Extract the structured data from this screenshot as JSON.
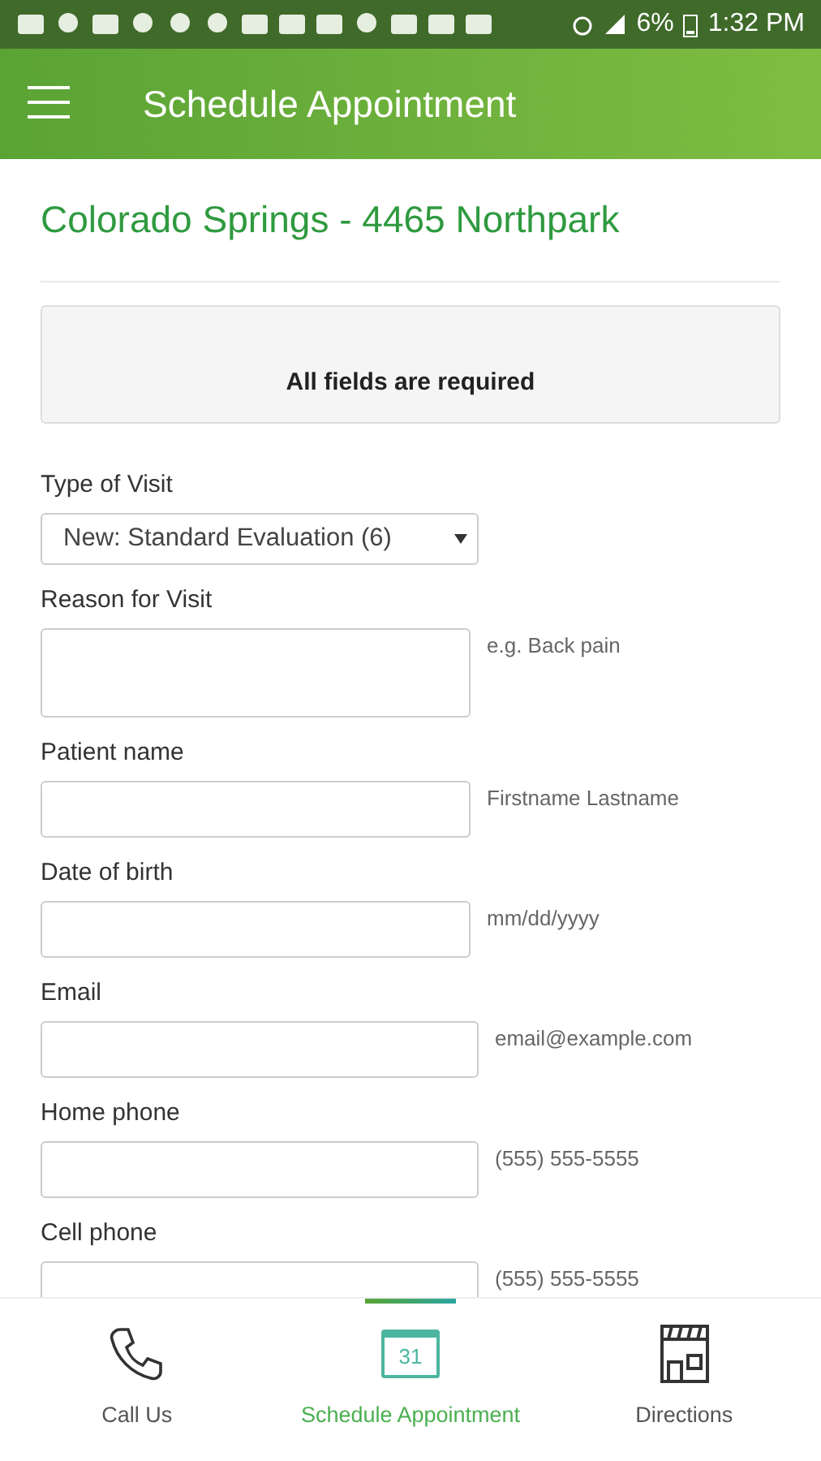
{
  "status_bar": {
    "battery": "6%",
    "time": "1:32 PM"
  },
  "app_bar": {
    "title": "Schedule Appointment"
  },
  "location": "Colorado Springs - 4465 Northpark",
  "notice": "All fields are required",
  "fields": [
    {
      "kind": "select",
      "label": "Type of Visit",
      "value": "New: Standard Evaluation (6)"
    },
    {
      "kind": "textarea",
      "label": "Reason for Visit",
      "hint": "e.g. Back pain"
    },
    {
      "kind": "input",
      "label": "Patient name",
      "hint": "Firstname Lastname"
    },
    {
      "kind": "input",
      "label": "Date of birth",
      "hint": "mm/dd/yyyy"
    },
    {
      "kind": "input",
      "label": "Email",
      "hint": "email@example.com"
    },
    {
      "kind": "input",
      "label": "Home phone",
      "hint": "(555) 555-5555"
    },
    {
      "kind": "input",
      "label": "Cell phone",
      "hint": "(555) 555-5555"
    }
  ],
  "bottom_nav": [
    {
      "kind": "phone",
      "label": "Call Us",
      "selected": false
    },
    {
      "kind": "calendar",
      "label": "Schedule Appointment",
      "icon_text": "31",
      "selected": true
    },
    {
      "kind": "store",
      "label": "Directions",
      "selected": false
    }
  ]
}
